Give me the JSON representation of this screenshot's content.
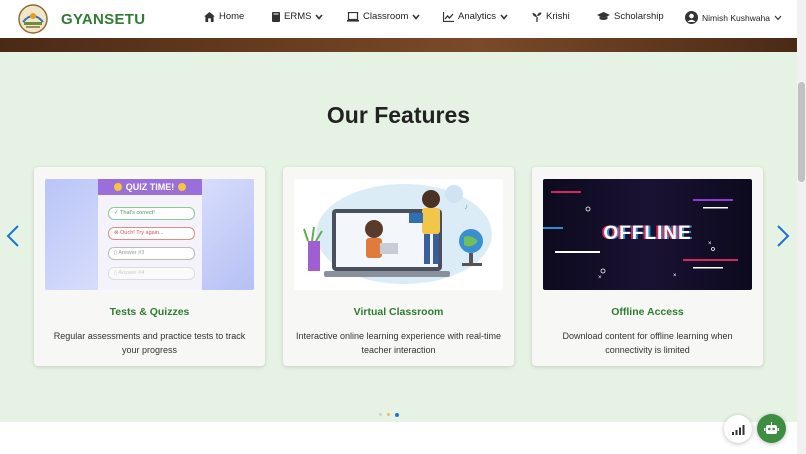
{
  "brand": {
    "name": "GYANSETU"
  },
  "nav": {
    "home": "Home",
    "erms": "ERMS",
    "classroom": "Classroom",
    "analytics": "Analytics",
    "krishi": "Krishi",
    "scholarship": "Scholarship",
    "user": "Nimish Kushwaha"
  },
  "features": {
    "title": "Our Features",
    "cards": [
      {
        "title": "Tests & Quizzes",
        "desc": "Regular assessments and practice tests to track your progress",
        "image": {
          "header": "QUIZ TIME!",
          "options": [
            "That's correct!",
            "Ouch! Try again...",
            "Answer #3",
            "Answer #4"
          ]
        }
      },
      {
        "title": "Virtual Classroom",
        "desc": "Interactive online learning experience with real-time teacher interaction"
      },
      {
        "title": "Offline Access",
        "desc": "Download content for offline learning when connectivity is limited",
        "image": {
          "word": "OFFLINE"
        }
      }
    ],
    "active_slide": 3,
    "slide_count": 3
  },
  "colors": {
    "brand_green": "#2e7d32",
    "section_bg": "#e6f2e4",
    "accent_blue": "#1976d2"
  },
  "icons": [
    "home-icon",
    "book-icon",
    "laptop-icon",
    "chart-line-icon",
    "seedling-icon",
    "graduation-cap-icon",
    "user-circle-icon",
    "chevron-left-icon",
    "chevron-right-icon",
    "signal-icon",
    "robot-icon"
  ]
}
